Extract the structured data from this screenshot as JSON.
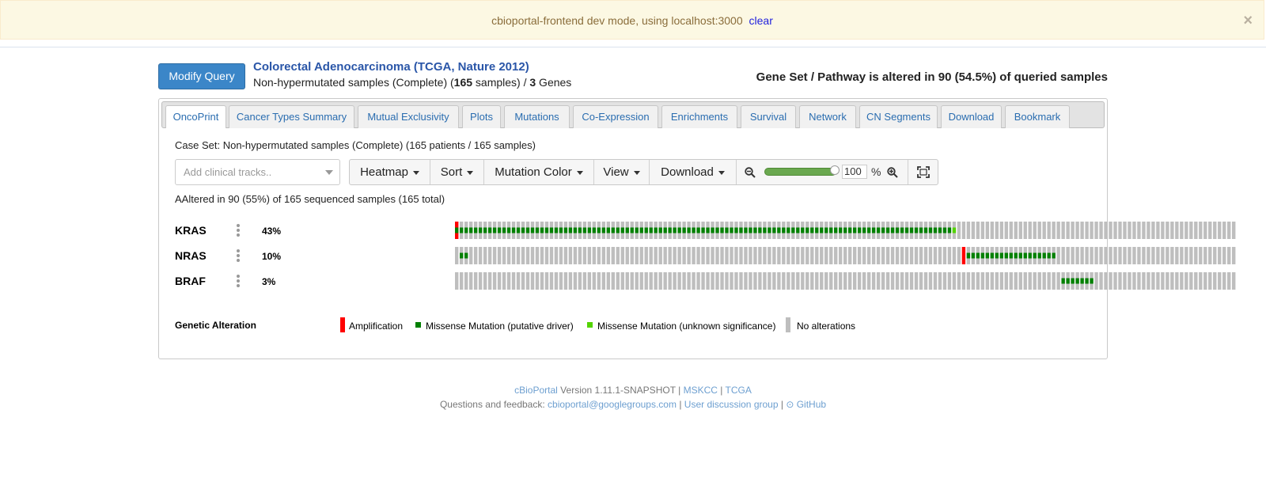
{
  "banner": {
    "message": "cbioportal-frontend dev mode, using localhost:3000",
    "clear_label": "clear",
    "close_glyph": "×"
  },
  "query": {
    "modify_label": "Modify Query",
    "study_title": "Colorectal Adenocarcinoma (TCGA, Nature 2012)",
    "subtitle_prefix": "Non-hypermutated samples (Complete)  (",
    "sample_count": "165",
    "subtitle_mid": " samples) / ",
    "gene_count": "3",
    "subtitle_suffix": " Genes",
    "altered_summary": "Gene Set / Pathway is altered in 90 (54.5%) of queried samples"
  },
  "tabs": [
    {
      "label": "OncoPrint",
      "active": true
    },
    {
      "label": "Cancer Types Summary"
    },
    {
      "label": "Mutual Exclusivity"
    },
    {
      "label": "Plots"
    },
    {
      "label": "Mutations"
    },
    {
      "label": "Co-Expression"
    },
    {
      "label": "Enrichments"
    },
    {
      "label": "Survival"
    },
    {
      "label": "Network"
    },
    {
      "label": "CN Segments"
    },
    {
      "label": "Download"
    },
    {
      "label": "Bookmark"
    }
  ],
  "oncoprint": {
    "case_set": "Case Set: Non-hypermutated samples (Complete) (165 patients / 165 samples)",
    "clinical_placeholder": "Add clinical tracks..",
    "toolbar": {
      "heatmap": "Heatmap",
      "sort": "Sort",
      "mutation_color": "Mutation Color",
      "view": "View",
      "download": "Download",
      "zoom_value": "100",
      "zoom_unit": "%",
      "zoom_fraction": 0.85
    },
    "altered_line": "AAltered in 90 (55%) of 165 sequenced samples (165 total)",
    "total_samples": 165,
    "genes": [
      {
        "name": "KRAS",
        "pct": "43%"
      },
      {
        "name": "NRAS",
        "pct": "10%"
      },
      {
        "name": "BRAF",
        "pct": "3%"
      }
    ],
    "alterations": {
      "KRAS": {
        "amp": [
          0
        ],
        "driver_range": [
          0,
          104
        ],
        "vus": [
          105
        ]
      },
      "NRAS": {
        "amp": [
          107
        ],
        "driver_range_pre": [
          1,
          2
        ],
        "driver_range": [
          108,
          126
        ]
      },
      "BRAF": {
        "driver_range": [
          128,
          134
        ]
      }
    },
    "colors": {
      "amplification": "#ff0000",
      "missense_driver": "#008000",
      "missense_vus": "#53d400",
      "no_alteration": "#bebebe"
    },
    "legend": {
      "title": "Genetic Alteration",
      "amplification": "Amplification",
      "driver": "Missense Mutation (putative driver)",
      "vus": "Missense Mutation (unknown significance)",
      "none": "No alterations"
    }
  },
  "footer": {
    "cbioportal": "cBioPortal",
    "version": " Version 1.11.1-SNAPSHOT | ",
    "mskcc": "MSKCC",
    "sep": " | ",
    "tcga": "TCGA",
    "questions": "Questions and feedback: ",
    "email": "cbioportal@googlegroups.com",
    "discussion": "User discussion group",
    "github": "GitHub"
  }
}
